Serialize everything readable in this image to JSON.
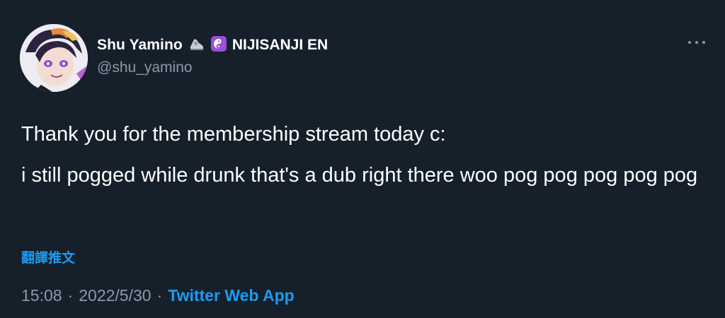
{
  "author": {
    "display_name": "Shu Yamino",
    "handle": "@shu_yamino",
    "org_label": "NIJISANJI EN",
    "badges": [
      "shoe-emoji",
      "yin-yang-emoji"
    ],
    "avatar": "avatar-image"
  },
  "tweet": {
    "paragraphs": [
      "Thank you for the membership stream today c:",
      "i still pogged while drunk that's a dub right there woo pog pog pog pog pog"
    ],
    "translate_label": "翻譯推文",
    "time": "15:08",
    "date": "2022/5/30",
    "separator": "·",
    "source": "Twitter Web App"
  },
  "icons": {
    "more": "more-icon"
  },
  "colors": {
    "background": "#15202b",
    "text": "#ffffff",
    "muted": "#8b98a5",
    "accent": "#1d9bf0",
    "badge_purple": "#9b4fd6"
  }
}
